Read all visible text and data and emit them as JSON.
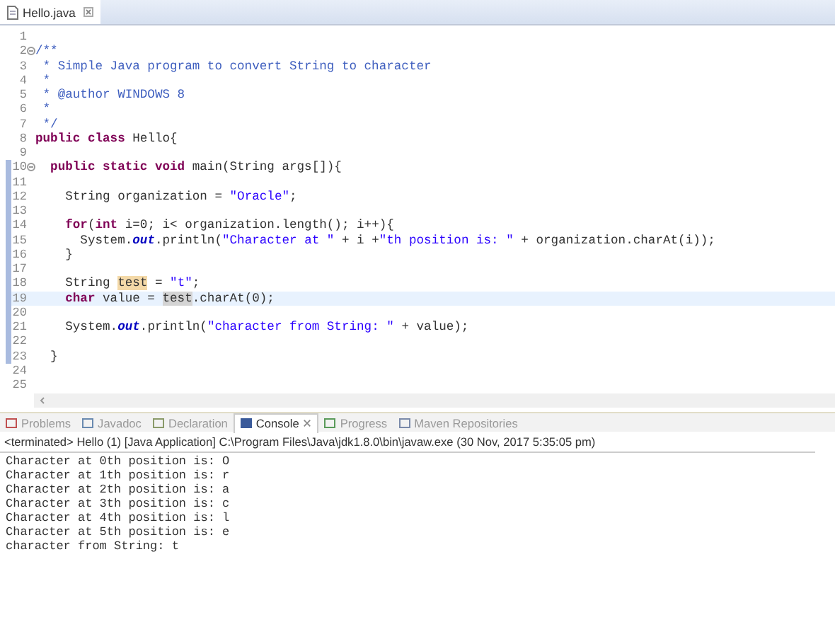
{
  "editor": {
    "tab": {
      "label": "Hello.java",
      "selected": true
    },
    "lines": [
      {
        "number": "1"
      },
      {
        "number": "2",
        "fold": true,
        "tokens": [
          {
            "kind": "cmt",
            "text": "/**"
          }
        ]
      },
      {
        "number": "3",
        "tokens": [
          {
            "kind": "cmt",
            "text": " * Simple Java program to convert String to character"
          }
        ]
      },
      {
        "number": "4",
        "tokens": [
          {
            "kind": "cmt",
            "text": " *"
          }
        ]
      },
      {
        "number": "5",
        "tokens": [
          {
            "kind": "cmt",
            "text": " * @author WINDOWS 8"
          }
        ]
      },
      {
        "number": "6",
        "tokens": [
          {
            "kind": "cmt",
            "text": " *"
          }
        ]
      },
      {
        "number": "7",
        "tokens": [
          {
            "kind": "cmt",
            "text": " */"
          }
        ]
      },
      {
        "number": "8",
        "tokens": [
          {
            "kind": "kw",
            "text": "public class "
          },
          {
            "kind": "plain",
            "text": "Hello{"
          }
        ]
      },
      {
        "number": "9"
      },
      {
        "number": "10",
        "fold": true,
        "scope": true,
        "tokens": [
          {
            "kind": "kw",
            "text": "  public static void "
          },
          {
            "kind": "plain",
            "text": "main(String args[]){"
          }
        ]
      },
      {
        "number": "11",
        "scope": true
      },
      {
        "number": "12",
        "scope": true,
        "tokens": [
          {
            "kind": "plain",
            "text": "    String organization = "
          },
          {
            "kind": "str",
            "text": "\"Oracle\""
          },
          {
            "kind": "plain",
            "text": ";"
          }
        ]
      },
      {
        "number": "13",
        "scope": true
      },
      {
        "number": "14",
        "scope": true,
        "tokens": [
          {
            "kind": "kw",
            "text": "    for"
          },
          {
            "kind": "plain",
            "text": "("
          },
          {
            "kind": "kw",
            "text": "int"
          },
          {
            "kind": "plain",
            "text": " i=0; i< organization.length(); i++){"
          }
        ]
      },
      {
        "number": "15",
        "scope": true,
        "tokens": [
          {
            "kind": "plain",
            "text": "      System."
          },
          {
            "kind": "field",
            "text": "out"
          },
          {
            "kind": "plain",
            "text": ".println("
          },
          {
            "kind": "str",
            "text": "\"Character at \""
          },
          {
            "kind": "plain",
            "text": " + i +"
          },
          {
            "kind": "str",
            "text": "\"th position is: \""
          },
          {
            "kind": "plain",
            "text": " + organization.charAt(i));"
          }
        ]
      },
      {
        "number": "16",
        "scope": true,
        "tokens": [
          {
            "kind": "plain",
            "text": "    }"
          }
        ]
      },
      {
        "number": "17",
        "scope": true
      },
      {
        "number": "18",
        "scope": true,
        "tokens": [
          {
            "kind": "plain",
            "text": "    String "
          },
          {
            "kind": "occ",
            "text": "test"
          },
          {
            "kind": "plain",
            "text": " = "
          },
          {
            "kind": "str",
            "text": "\"t\""
          },
          {
            "kind": "plain",
            "text": ";"
          }
        ]
      },
      {
        "number": "19",
        "scope": true,
        "current": true,
        "tokens": [
          {
            "kind": "kw",
            "text": "    char"
          },
          {
            "kind": "plain",
            "text": " value = "
          },
          {
            "kind": "occ2",
            "text": "test"
          },
          {
            "kind": "plain",
            "text": ".charAt(0);"
          }
        ]
      },
      {
        "number": "20",
        "scope": true
      },
      {
        "number": "21",
        "scope": true,
        "tokens": [
          {
            "kind": "plain",
            "text": "    System."
          },
          {
            "kind": "field",
            "text": "out"
          },
          {
            "kind": "plain",
            "text": ".println("
          },
          {
            "kind": "str",
            "text": "\"character from String: \""
          },
          {
            "kind": "plain",
            "text": " + value);"
          }
        ]
      },
      {
        "number": "22",
        "scope": true
      },
      {
        "number": "23",
        "scope": true,
        "tokens": [
          {
            "kind": "plain",
            "text": "  }"
          }
        ]
      },
      {
        "number": "24"
      },
      {
        "number": "25"
      }
    ]
  },
  "panel": {
    "tabs": [
      {
        "label": "Problems",
        "selected": false
      },
      {
        "label": "Javadoc",
        "selected": false
      },
      {
        "label": "Declaration",
        "selected": false
      },
      {
        "label": "Console",
        "selected": true
      },
      {
        "label": "Progress",
        "selected": false
      },
      {
        "label": "Maven Repositories",
        "selected": false
      }
    ],
    "status": "<terminated> Hello (1) [Java Application] C:\\Program Files\\Java\\jdk1.8.0\\bin\\javaw.exe (30 Nov, 2017 5:35:05 pm)",
    "output": [
      "Character at 0th position is: O",
      "Character at 1th position is: r",
      "Character at 2th position is: a",
      "Character at 3th position is: c",
      "Character at 4th position is: l",
      "Character at 5th position is: e",
      "character from String: t"
    ]
  }
}
